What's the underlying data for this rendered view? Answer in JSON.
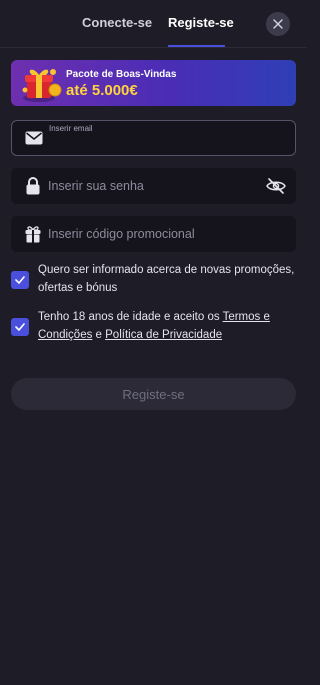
{
  "tabs": {
    "login": "Conecte-se",
    "register": "Registe-se"
  },
  "banner": {
    "title": "Pacote de Boas-Vindas",
    "amount": "até 5.000€"
  },
  "form": {
    "email": {
      "label": "Inserir email",
      "value": ""
    },
    "password": {
      "placeholder": "Inserir sua senha",
      "value": ""
    },
    "promo": {
      "placeholder": "Inserir código promocional",
      "value": ""
    }
  },
  "consents": {
    "marketing": {
      "text": "Quero ser informado acerca de novas promoções, ofertas e bónus",
      "checked": true
    },
    "terms": {
      "text_before": "Tenho 18 anos de idade e aceito os ",
      "terms_link": "Termos e Condições",
      "connector": " e ",
      "privacy_link": "Política de Privacidade",
      "checked": true
    }
  },
  "submit_label": "Registe-se",
  "icons": {
    "close": "close-icon",
    "gift_banner": "gift-box-icon",
    "email": "envelope-icon",
    "password": "lock-icon",
    "visibility": "eye-off-icon",
    "promo": "gift-icon",
    "check": "checkmark-icon"
  },
  "colors": {
    "background": "#1d1c27",
    "accent": "#4a4fdc",
    "banner_amount": "#ffd43a",
    "input_bg": "#15141d",
    "button_disabled_bg": "#2b2a36"
  }
}
